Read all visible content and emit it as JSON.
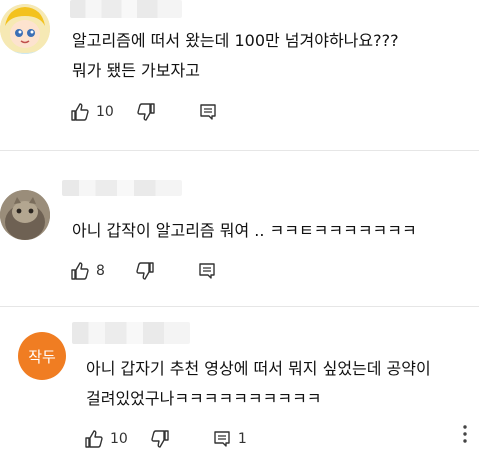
{
  "comments": [
    {
      "lines": [
        "알고리즘에 떠서 왔는데 100만 넘겨야하나요???",
        "뭐가 됐든 가보자고"
      ],
      "likes": "10",
      "avatar": "cartoon-face"
    },
    {
      "lines": [
        "아니 갑작이 알고리즘 뭐여 .. ㅋㅋㅌㅋㅋㅋㅋㅋㅋㅋ"
      ],
      "likes": "8",
      "avatar": "photo"
    },
    {
      "lines": [
        "아니 갑자기 추천 영상에 떠서 뭐지 싶었는데 공약이",
        "걸려있었구나ㅋㅋㅋㅋㅋㅋㅋㅋㅋㅋ"
      ],
      "likes": "10",
      "replies": "1",
      "avatar_text": "작두",
      "avatar_color": "#f07d22"
    }
  ],
  "icons": {
    "like": "thumbs-up-icon",
    "dislike": "thumbs-down-icon",
    "reply": "comment-icon",
    "more": "more-vertical-icon"
  }
}
